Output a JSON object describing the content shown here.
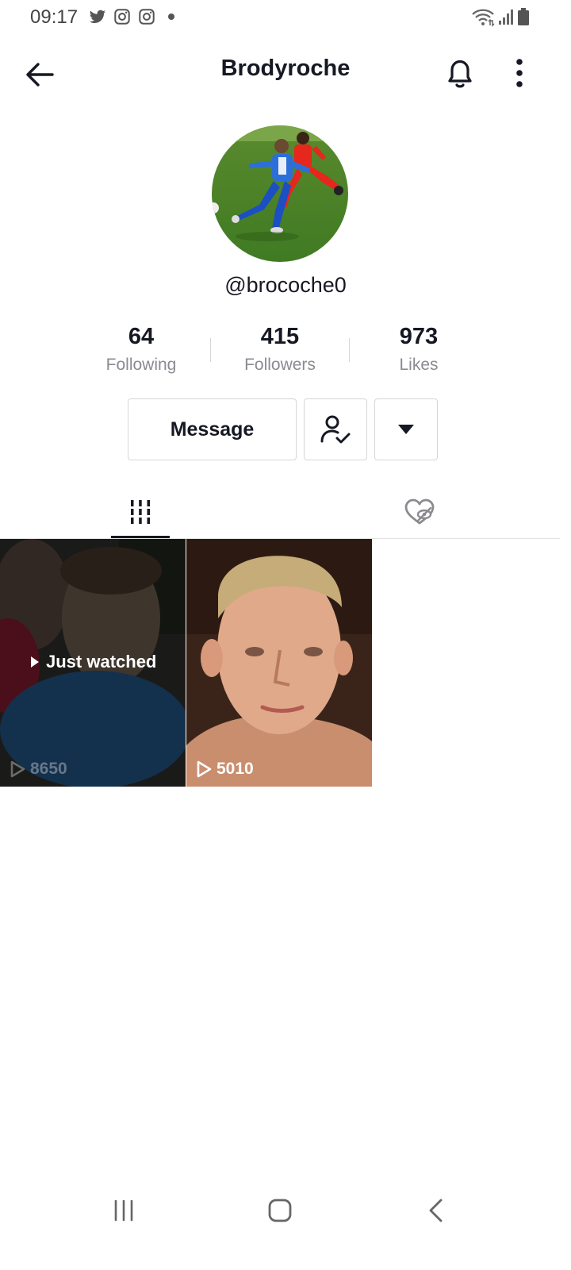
{
  "status_bar": {
    "time": "09:17",
    "icons": [
      "twitter-icon",
      "instagram-icon",
      "instagram-icon",
      "notification-dot",
      "wifi-icon",
      "signal-icon",
      "battery-icon"
    ]
  },
  "header": {
    "title": "Brodyroche",
    "back_icon": "arrow-left-icon",
    "bell_icon": "bell-icon",
    "more_icon": "vertical-dots-icon"
  },
  "profile": {
    "handle": "@brocoche0",
    "stats": {
      "following": {
        "value": "64",
        "label": "Following"
      },
      "followers": {
        "value": "415",
        "label": "Followers"
      },
      "likes": {
        "value": "973",
        "label": "Likes"
      }
    }
  },
  "actions": {
    "message_label": "Message",
    "friends_icon": "user-check-icon",
    "dropdown_icon": "caret-down-icon"
  },
  "tabs": [
    {
      "name": "videos",
      "icon": "grid-columns-icon",
      "active": true
    },
    {
      "name": "liked",
      "icon": "heart-hidden-icon",
      "active": false
    }
  ],
  "videos": [
    {
      "views": "8650",
      "badge": "Just watched",
      "dimmed": true
    },
    {
      "views": "5010",
      "badge": "",
      "dimmed": false
    }
  ],
  "colors": {
    "text_primary": "#161823",
    "text_secondary": "#8a8b91",
    "border": "#d6d6d6"
  },
  "nav_bar": {
    "icons": [
      "recent-apps-icon",
      "home-icon",
      "back-icon"
    ]
  }
}
